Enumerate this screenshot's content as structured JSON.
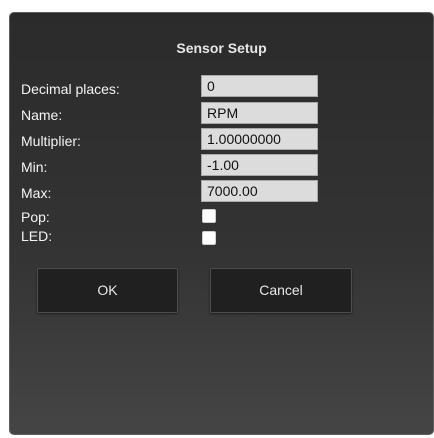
{
  "dialog": {
    "title": "Sensor Setup",
    "fields": [
      {
        "label": "Decimal places:",
        "value": "0"
      },
      {
        "label": "Name:",
        "value": "RPM"
      },
      {
        "label": "Multiplier:",
        "value": "1.00000000"
      },
      {
        "label": "Min:",
        "value": "-1.00"
      },
      {
        "label": "Max:",
        "value": "7000.00"
      }
    ],
    "checkboxes": [
      {
        "label": "Pop:",
        "checked": false
      },
      {
        "label": "LED:",
        "checked": false
      }
    ],
    "buttons": {
      "ok_label": "OK",
      "cancel_label": "Cancel"
    }
  }
}
